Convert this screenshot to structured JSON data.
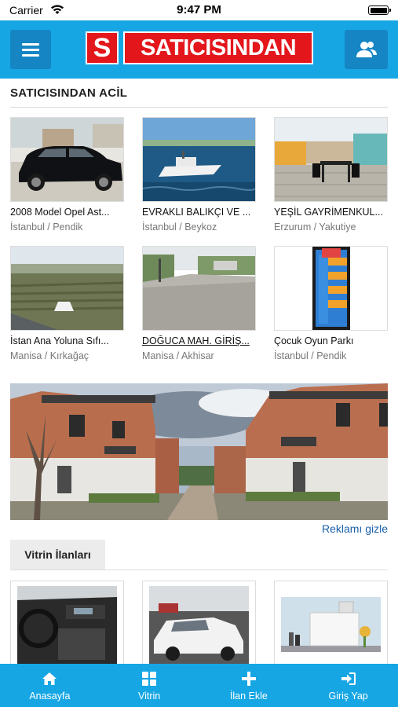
{
  "status_bar": {
    "carrier": "Carrier",
    "time": "9:47 PM"
  },
  "header": {
    "logo_mark": "S",
    "logo_text": "SATICISINDAN",
    "brand_color": "#17a6e4",
    "logo_color": "#e3161b"
  },
  "section": {
    "title": "SATICISINDAN ACİL"
  },
  "listings": [
    {
      "title": "2008 Model Opel Ast...",
      "location": "İstanbul / Pendik"
    },
    {
      "title": "EVRAKLI BALIKÇI VE ...",
      "location": "İstanbul / Beykoz"
    },
    {
      "title": "YEŞİL GAYRİMENKUL...",
      "location": "Erzurum / Yakutiye"
    },
    {
      "title": "İstan Ana Yoluna Sıfı...",
      "location": "Manisa / Kırkağaç"
    },
    {
      "title": "DOĞUCA MAH. GİRİŞ...",
      "location": "Manisa / Akhisar"
    },
    {
      "title": "Çocuk Oyun Parkı",
      "location": "İstanbul / Pendik"
    }
  ],
  "ad": {
    "hide_label": "Reklamı gizle"
  },
  "vitrin": {
    "title": "Vitrin İlanları"
  },
  "tab_bar": {
    "items": [
      {
        "label": "Anasayfa",
        "icon": "home-icon"
      },
      {
        "label": "Vitrin",
        "icon": "grid-icon"
      },
      {
        "label": "İlan Ekle",
        "icon": "plus-icon"
      },
      {
        "label": "Giriş Yap",
        "icon": "sign-in-icon"
      }
    ]
  }
}
